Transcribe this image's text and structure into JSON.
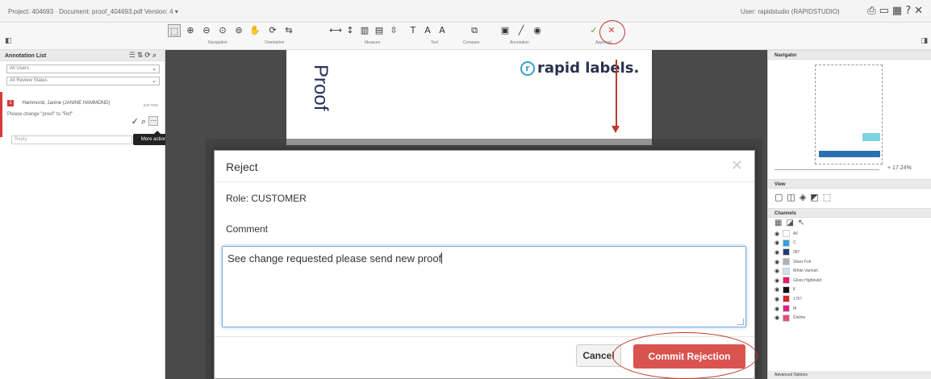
{
  "topbar": {
    "project_info": "Project: 404693 · Document: proof_404693.pdf Version: 4 ▾",
    "user": "User: rapidstudio (RAPIDSTUDIO)",
    "icons": [
      "print-icon",
      "window-icon",
      "grid-icon",
      "help-icon",
      "close-icon"
    ]
  },
  "toolbar": {
    "groups": [
      "Navigation",
      "Orientation",
      "Measure",
      "Text",
      "Compare",
      "Annotation",
      "Approval"
    ],
    "tooltip_more_actions": "More actions"
  },
  "left_panel": {
    "title": "Annotation List",
    "filter_users": "All Users",
    "filter_states": "All Review States",
    "annotation": {
      "number": "1",
      "author": "Hammond, Janine (JANINE HAMMOND)",
      "message": "Please change \"proof\" to \"Ref\"",
      "time": "just now"
    },
    "reply_placeholder": "Reply"
  },
  "document": {
    "proof_text": "Proof",
    "logo_symbol": "r",
    "logo_text": "rapid labels."
  },
  "right_panel": {
    "navigator_title": "Navigator",
    "zoom": "17.24%",
    "view_title": "View",
    "channels_title": "Channels",
    "channels": [
      {
        "name": "All",
        "color": "#ffffff"
      },
      {
        "name": "C",
        "color": "#2fa3d8"
      },
      {
        "name": "287",
        "color": "#1f3a7a"
      },
      {
        "name": "Silver Foil",
        "color": "#b0b0b0"
      },
      {
        "name": "White Varnish",
        "color": "#c9e4ee"
      },
      {
        "name": "Gloss Highbuild",
        "color": "#e6196b"
      },
      {
        "name": "K",
        "color": "#111111"
      },
      {
        "name": "1757",
        "color": "#d8232a"
      },
      {
        "name": "M",
        "color": "#e0208a"
      },
      {
        "name": "Dieline",
        "color": "#e8487a"
      }
    ],
    "bottom_title": "Advanced Options"
  },
  "modal": {
    "title": "Reject",
    "role": "Role: CUSTOMER",
    "comment_label": "Comment",
    "comment_value": "See change requested please send new proof",
    "cancel_label": "Cancel",
    "commit_label": "Commit Rejection"
  }
}
